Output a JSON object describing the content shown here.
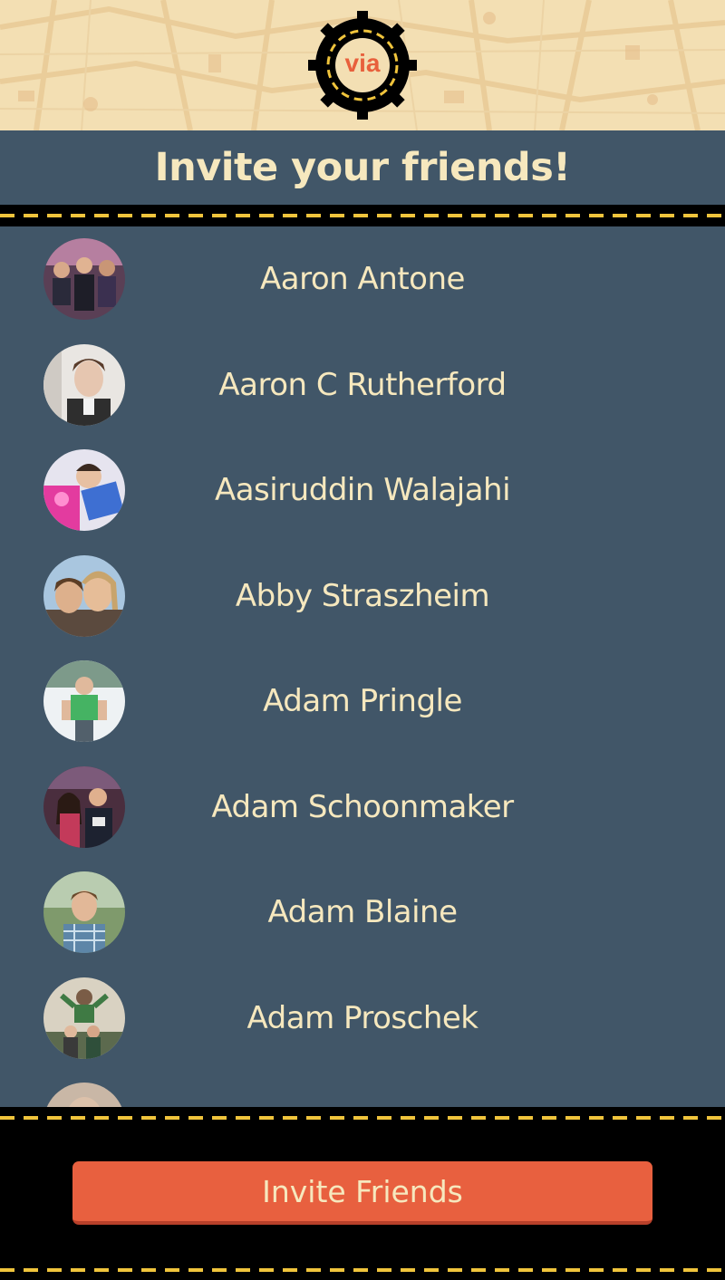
{
  "header": {
    "logo_text": "via"
  },
  "title": "Invite your friends!",
  "friends": [
    {
      "name": "Aaron Antone",
      "avatar": "avatar-group-photo"
    },
    {
      "name": "Aaron C Rutherford",
      "avatar": "avatar-person-photo"
    },
    {
      "name": "Aasiruddin Walajahi",
      "avatar": "avatar-person-photo"
    },
    {
      "name": "Abby Straszheim",
      "avatar": "avatar-person-photo"
    },
    {
      "name": "Adam Pringle",
      "avatar": "avatar-person-photo"
    },
    {
      "name": "Adam Schoonmaker",
      "avatar": "avatar-person-photo"
    },
    {
      "name": "Adam Blaine",
      "avatar": "avatar-person-photo"
    },
    {
      "name": "Adam Proschek",
      "avatar": "avatar-person-photo"
    },
    {
      "name": "",
      "avatar": "avatar-person-photo"
    }
  ],
  "footer": {
    "invite_button_label": "Invite Friends"
  },
  "colors": {
    "panel": "#415668",
    "text": "#f6e8be",
    "accent": "#e8603f",
    "road_stripe": "#f0c43c",
    "map_bg": "#f3dfb3"
  }
}
